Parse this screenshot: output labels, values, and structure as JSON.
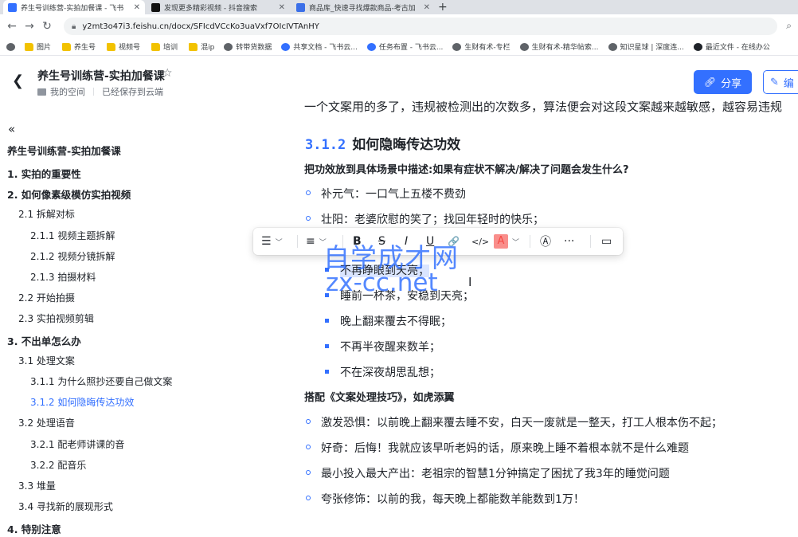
{
  "browser": {
    "tabs": [
      {
        "title": "养生号训练营-实拍加餐课 - 飞书",
        "active": true,
        "favicon_color": "#3370ff"
      },
      {
        "title": "发现更多精彩视频 - 抖音搜索",
        "active": false,
        "favicon_color": "#111111"
      },
      {
        "title": "商品库_快速寻找爆款商品-考古加",
        "active": false,
        "favicon_color": "#3b6fe8"
      }
    ],
    "new_tab": "+",
    "url": "y2mt3o47i3.feishu.cn/docx/SFIcdVCcKo3uaVxf7OIcIVTAnHY",
    "bookmarks": [
      {
        "label": "图片",
        "icon": "folder"
      },
      {
        "label": "养生号",
        "icon": "folder"
      },
      {
        "label": "视频号",
        "icon": "folder"
      },
      {
        "label": "培训",
        "icon": "folder"
      },
      {
        "label": "混ip",
        "icon": "folder"
      },
      {
        "label": "转带货数据",
        "icon": "globe"
      },
      {
        "label": "共享文档 - 飞书云...",
        "icon": "blue"
      },
      {
        "label": "任务布置 - 飞书云...",
        "icon": "blue"
      },
      {
        "label": "生财有术-专栏",
        "icon": "globe"
      },
      {
        "label": "生财有术-精华帖索...",
        "icon": "globe"
      },
      {
        "label": "知识星球 | 深度连...",
        "icon": "globe"
      },
      {
        "label": "最近文件 - 在线办公",
        "icon": "dark"
      }
    ]
  },
  "doc": {
    "title": "养生号训练营-实拍加餐课",
    "space": "我的空间",
    "save_status": "已经保存到云端",
    "share_label": "分享",
    "edit_label": "编"
  },
  "outline": {
    "items": [
      {
        "label": "养生号训练营-实拍加餐课",
        "level": 0
      },
      {
        "label": "1. 实拍的重要性",
        "level": 1
      },
      {
        "label": "2. 如何像素级模仿实拍视频",
        "level": 1
      },
      {
        "label": "2.1 拆解对标",
        "level": 2
      },
      {
        "label": "2.1.1 视频主题拆解",
        "level": 3
      },
      {
        "label": "2.1.2 视频分镜拆解",
        "level": 3
      },
      {
        "label": "2.1.3 拍摄材料",
        "level": 3
      },
      {
        "label": "2.2 开始拍摄",
        "level": 2
      },
      {
        "label": "2.3 实拍视频剪辑",
        "level": 2
      },
      {
        "label": "3. 不出单怎么办",
        "level": 1
      },
      {
        "label": "3.1 处理文案",
        "level": 2
      },
      {
        "label": "3.1.1 为什么照抄还要自己做文案",
        "level": 3
      },
      {
        "label": "3.1.2 如何隐晦传达功效",
        "level": 3,
        "active": true
      },
      {
        "label": "3.2 处理语音",
        "level": 2
      },
      {
        "label": "3.2.1 配老师讲课的音",
        "level": 3
      },
      {
        "label": "3.2.2 配音乐",
        "level": 3
      },
      {
        "label": "3.3 堆量",
        "level": 2
      },
      {
        "label": "3.4 寻找新的展现形式",
        "level": 2
      },
      {
        "label": "4. 特别注意",
        "level": 1
      }
    ]
  },
  "content": {
    "cut_line": "一个文案用的多了，违规被检测出的次数多，算法便会对这段文案越来越敏感，越容易违规",
    "heading_num": "3.1.2",
    "heading_text": "如何隐晦传达功效",
    "para1": "把功效放到具体场景中描述:如果有症状不解决/解决了问题会发生什么?",
    "bullets1": [
      "补元气：一口气上五楼不费劲",
      "壮阳：老婆欣慰的笑了；找回年轻时的快乐；"
    ],
    "bullets2": [
      "不再睁眼到天亮；",
      "睡前一杯茶，安稳到天亮；",
      "晚上翻来覆去不得眠；",
      "不再半夜醒来数羊；",
      "不在深夜胡思乱想；"
    ],
    "para2": "搭配《文案处理技巧》，如虎添翼",
    "bullets3": [
      "激发恐惧：以前晚上翻来覆去睡不安，白天一废就是一整天，打工人根本伤不起；",
      "好奇：后悔！我就应该早听老妈的话，原来晚上睡不着根本就不是什么难题",
      "最小投入最大产出：老祖宗的智慧1分钟搞定了困扰了我3年的睡觉问题",
      "夸张修饰：以前的我，每天晚上都能数羊能数到1万！"
    ]
  },
  "toolbar": {
    "list_icon": "☰",
    "align_icon": "≡",
    "bold": "B",
    "strike": "S",
    "italic": "I",
    "underline": "U",
    "link_icon": "🔗",
    "code_icon": "</>",
    "font_color": "A",
    "more": "···",
    "comment_icon": "▭"
  },
  "watermark": {
    "line1": "自学成才网",
    "line2": "zx-cc.net"
  }
}
